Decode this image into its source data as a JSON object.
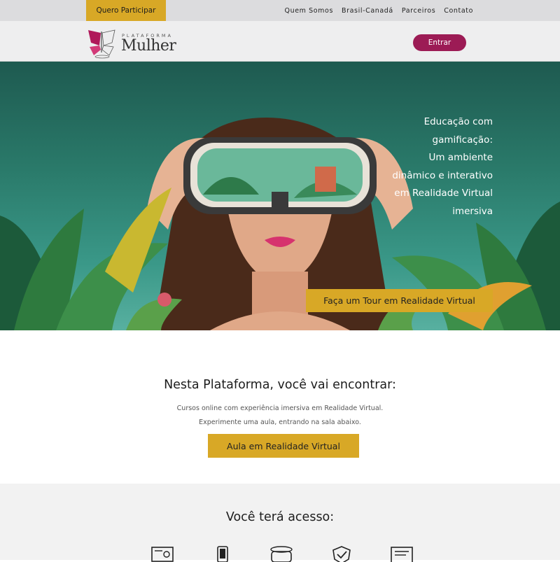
{
  "topbar": {
    "cta_label": "Quero Participar",
    "nav": [
      "Quem Somos",
      "Brasil-Canadá",
      "Parceiros",
      "Contato"
    ]
  },
  "header": {
    "logo_small": "PLATAFORMA",
    "logo_big": "Mulher",
    "login_label": "Entrar"
  },
  "hero": {
    "lines": [
      "Educação com",
      "gamificação:",
      "Um ambiente",
      "dinâmico e interativo",
      "em Realidade Virtual",
      "imersiva"
    ],
    "tour_button": "Faça um Tour em Realidade Virtual"
  },
  "platform": {
    "title": "Nesta Plataforma, você vai encontrar:",
    "desc1": "Cursos online com experiência imersiva em Realidade Virtual.",
    "desc2": "Experimente uma aula, entrando na sala abaixo.",
    "button": "Aula em Realidade Virtual"
  },
  "access": {
    "title": "Você terá acesso:",
    "icons": [
      "certificate-icon",
      "phone-icon",
      "vr-headset-icon",
      "shield-check-icon",
      "document-icon"
    ]
  },
  "colors": {
    "gold": "#d8a826",
    "magenta": "#9c1b55",
    "teal": "#2a7a6a"
  }
}
